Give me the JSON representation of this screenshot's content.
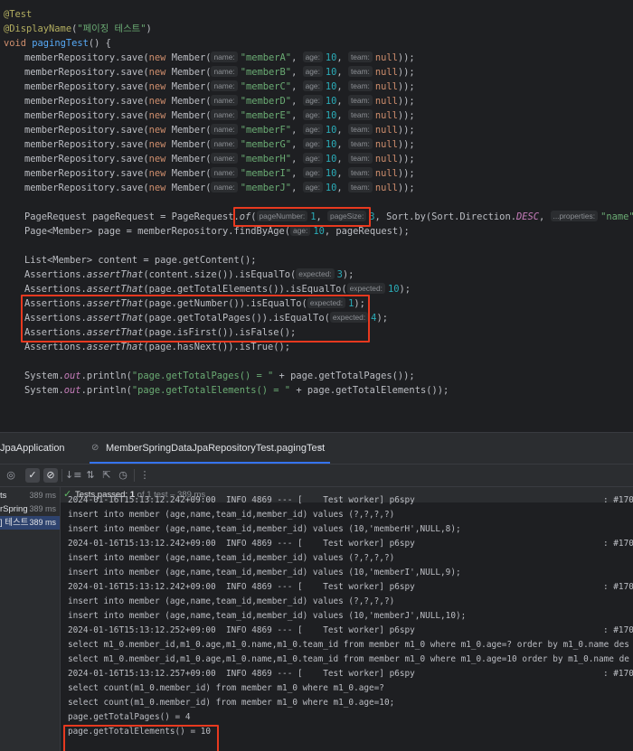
{
  "code": {
    "annotation_test": "@Test",
    "annotation_display": "@DisplayName",
    "display_name_arg": "\"페이징 테스트\"",
    "method_sig": "void",
    "method_name": "pagingTest",
    "method_rest": "() {",
    "saves": [
      {
        "name": "\"memberA\""
      },
      {
        "name": "\"memberB\""
      },
      {
        "name": "\"memberC\""
      },
      {
        "name": "\"memberD\""
      },
      {
        "name": "\"memberE\""
      },
      {
        "name": "\"memberF\""
      },
      {
        "name": "\"memberG\""
      },
      {
        "name": "\"memberH\""
      },
      {
        "name": "\"memberI\""
      },
      {
        "name": "\"memberJ\""
      }
    ],
    "save_prefix": "memberRepository.save(",
    "new_kw": "new",
    "member_cls": "Member(",
    "hint_name": "name:",
    "hint_age": "age:",
    "age_val": "10",
    "hint_team": "team:",
    "null_kw": "null",
    "save_suffix": "));",
    "pagerequest_lhs": "PageRequest pageRequest = PageRequest.",
    "of_method": "of",
    "hint_pagenumber": "pageNumber:",
    "pagenumber_val": "1",
    "hint_pagesize": "pageSize:",
    "pagesize_val": "3",
    "sort_part": " Sort.by(Sort.Direction.",
    "desc": "DESC",
    "hint_properties": "...properties:",
    "sort_prop": "\"name\"",
    "page_decl": "Page<Member> page = memberRepository.findByAge(",
    "page_age_val": "10",
    "page_decl_end": ", pageRequest);",
    "content_decl": "List<Member> content = page.getContent();",
    "assertions_prefix": "Assertions.",
    "assert_that": "assertThat",
    "hint_expected": "expected:",
    "a1_mid": "(content.size()).isEqualTo(",
    "a1_val": "3",
    "a2_mid": "(page.getTotalElements()).isEqualTo(",
    "a2_val": "10",
    "a3_mid": "(page.getNumber()).isEqualTo(",
    "a3_val": "1",
    "a4_mid": "(page.getTotalPages()).isEqualTo(",
    "a4_val": "4",
    "a5": "(page.isFirst()).isFalse();",
    "a6": "(page.hasNext()).isTrue();",
    "close_paren": ");",
    "println1_a": "System.",
    "out_kw": "out",
    "println1_b": ".println(",
    "println1_str": "\"page.getTotalPages() = \"",
    "println1_c": " + page.getTotalPages());",
    "println2_str": "\"page.getTotalElements() = \"",
    "println2_c": " + page.getTotalElements());"
  },
  "tool_window": {
    "tab1": "JpaApplication",
    "tab2": "MemberSpringDataJpaRepositoryTest.pagingTest",
    "status_prefix": "Tests passed:",
    "status_count": "1",
    "status_suffix": "of 1 test – 389 ms",
    "tree": [
      {
        "label": "ts",
        "time": "389 ms"
      },
      {
        "label": "rSpring",
        "time": "389 ms"
      },
      {
        "label": "] 테스트",
        "time": "389 ms"
      }
    ],
    "output": [
      "2024-01-16T15:13:12.242+09:00  INFO 4869 --- [    Test worker] p6spy",
      "insert into member (age,name,team_id,member_id) values (?,?,?,?)",
      "insert into member (age,name,team_id,member_id) values (10,'memberH',NULL,8);",
      "2024-01-16T15:13:12.242+09:00  INFO 4869 --- [    Test worker] p6spy",
      "insert into member (age,name,team_id,member_id) values (?,?,?,?)",
      "insert into member (age,name,team_id,member_id) values (10,'memberI',NULL,9);",
      "2024-01-16T15:13:12.242+09:00  INFO 4869 --- [    Test worker] p6spy",
      "insert into member (age,name,team_id,member_id) values (?,?,?,?)",
      "insert into member (age,name,team_id,member_id) values (10,'memberJ',NULL,10);",
      "2024-01-16T15:13:12.252+09:00  INFO 4869 --- [    Test worker] p6spy",
      "select m1_0.member_id,m1_0.age,m1_0.name,m1_0.team_id from member m1_0 where m1_0.age=? order by m1_0.name des",
      "select m1_0.member_id,m1_0.age,m1_0.name,m1_0.team_id from member m1_0 where m1_0.age=10 order by m1_0.name de",
      "2024-01-16T15:13:12.257+09:00  INFO 4869 --- [    Test worker] p6spy",
      "select count(m1_0.member_id) from member m1_0 where m1_0.age=?",
      "select count(m1_0.member_id) from member m1_0 where m1_0.age=10;",
      "page.getTotalPages() = 4",
      "page.getTotalElements() = 10"
    ],
    "thread_ids": [
      ": #170",
      ": #170",
      ": #170",
      ": #170",
      ": #170"
    ]
  },
  "colors": {
    "background": "#1e1f22",
    "keyword": "#cf8e6d",
    "string": "#6aab73",
    "number": "#2aacb8",
    "field": "#c77dbb",
    "annotation": "#b3ae60",
    "highlight_box": "#e8391f",
    "success": "#5fb865"
  }
}
